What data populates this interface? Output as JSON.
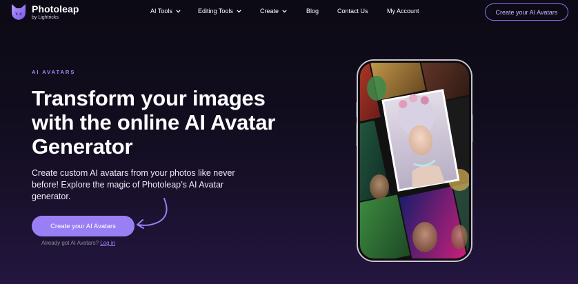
{
  "brand": {
    "name": "Photoleap",
    "sub": "by Lightricks",
    "accent": "#9a7ff4",
    "logo_icon": "fox-logo-icon"
  },
  "nav": {
    "items": [
      {
        "label": "AI Tools",
        "dropdown": true
      },
      {
        "label": "Editing Tools",
        "dropdown": true
      },
      {
        "label": "Create",
        "dropdown": true
      },
      {
        "label": "Blog",
        "dropdown": false
      },
      {
        "label": "Contact Us",
        "dropdown": false
      },
      {
        "label": "My Account",
        "dropdown": false
      }
    ],
    "cta": "Create your AI Avatars"
  },
  "hero": {
    "eyebrow": "AI AVATARS",
    "title": "Transform your images with the online AI Avatar Generator",
    "description": "Create custom AI avatars from your photos like never before! Explore the magic of Photoleap’s AI Avatar generator.",
    "cta": "Create your AI Avatars",
    "login_prompt": "Already got AI Avatars?",
    "login_link": "Log in"
  },
  "phone": {
    "content": "avatar-collage-image"
  }
}
